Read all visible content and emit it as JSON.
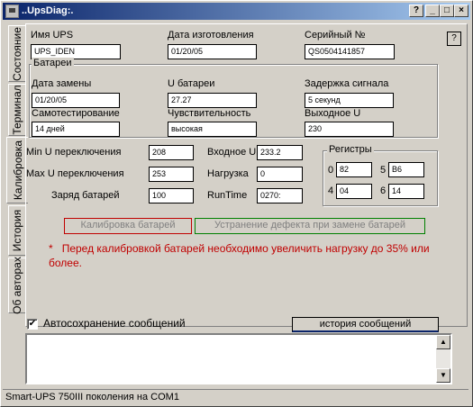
{
  "window": {
    "title": "..UpsDiag:.",
    "help_glyph": "?",
    "minimize_glyph": "_",
    "maximize_glyph": "□",
    "close_glyph": "×"
  },
  "tabs": [
    {
      "label": "Состояние",
      "active": false
    },
    {
      "label": "Терминал",
      "active": false
    },
    {
      "label": "Калибровка",
      "active": true
    },
    {
      "label": "История",
      "active": false
    },
    {
      "label": "Об авторах",
      "active": false
    }
  ],
  "info": {
    "ups_name_label": "Имя UPS",
    "ups_name_value": "UPS_IDEN",
    "mfg_date_label": "Дата изготовления",
    "mfg_date_value": "01/20/05",
    "serial_label": "Серийный №",
    "serial_value": "QS0504141857",
    "help_label": "?"
  },
  "battery": {
    "title": "Батареи",
    "replace_date_label": "Дата замены",
    "replace_date_value": "01/20/05",
    "u_battery_label": "U батареи",
    "u_battery_value": "27.27",
    "signal_delay_label": "Задержка сигнала",
    "signal_delay_value": "5 секунд",
    "selftest_label": "Самотестирование",
    "selftest_value": "14 дней",
    "sensitivity_label": "Чувствительность",
    "sensitivity_value": "высокая",
    "output_u_label": "Выходное U",
    "output_u_value": "230"
  },
  "params": {
    "min_u_label": "Min U переключения",
    "min_u_value": "208",
    "max_u_label": "Max U переключения",
    "max_u_value": "253",
    "charge_label": "Заряд батарей",
    "charge_value": "100",
    "input_u_label": "Входное U",
    "input_u_value": "233.2",
    "load_label": "Нагрузка",
    "load_value": "0",
    "runtime_label": "RunTime",
    "runtime_value": "0270:"
  },
  "registers": {
    "title": "Регистры",
    "r0_label": "0",
    "r0_value": "82",
    "r5_label": "5",
    "r5_value": "B6",
    "r4_label": "4",
    "r4_value": "04",
    "r6_label": "6",
    "r6_value": "14"
  },
  "actions": {
    "calibrate_label": "Калибровка батарей",
    "calibrate_color": "#c00000",
    "fix_label": "Устранение дефекта при замене батарей",
    "fix_color": "#008000"
  },
  "note": {
    "asterisk": "*",
    "text": "Перед калибровкой батарей необходимо увеличить нагрузку до 35% или более."
  },
  "autosave": {
    "label": "Автосохранение сообщений",
    "checked": true,
    "check_glyph": "✔"
  },
  "history_button_label": "история сообщений",
  "log": {
    "up_arrow": "▲",
    "down_arrow": "▼"
  },
  "statusbar_text": "Smart-UPS 750III поколения на COM1"
}
